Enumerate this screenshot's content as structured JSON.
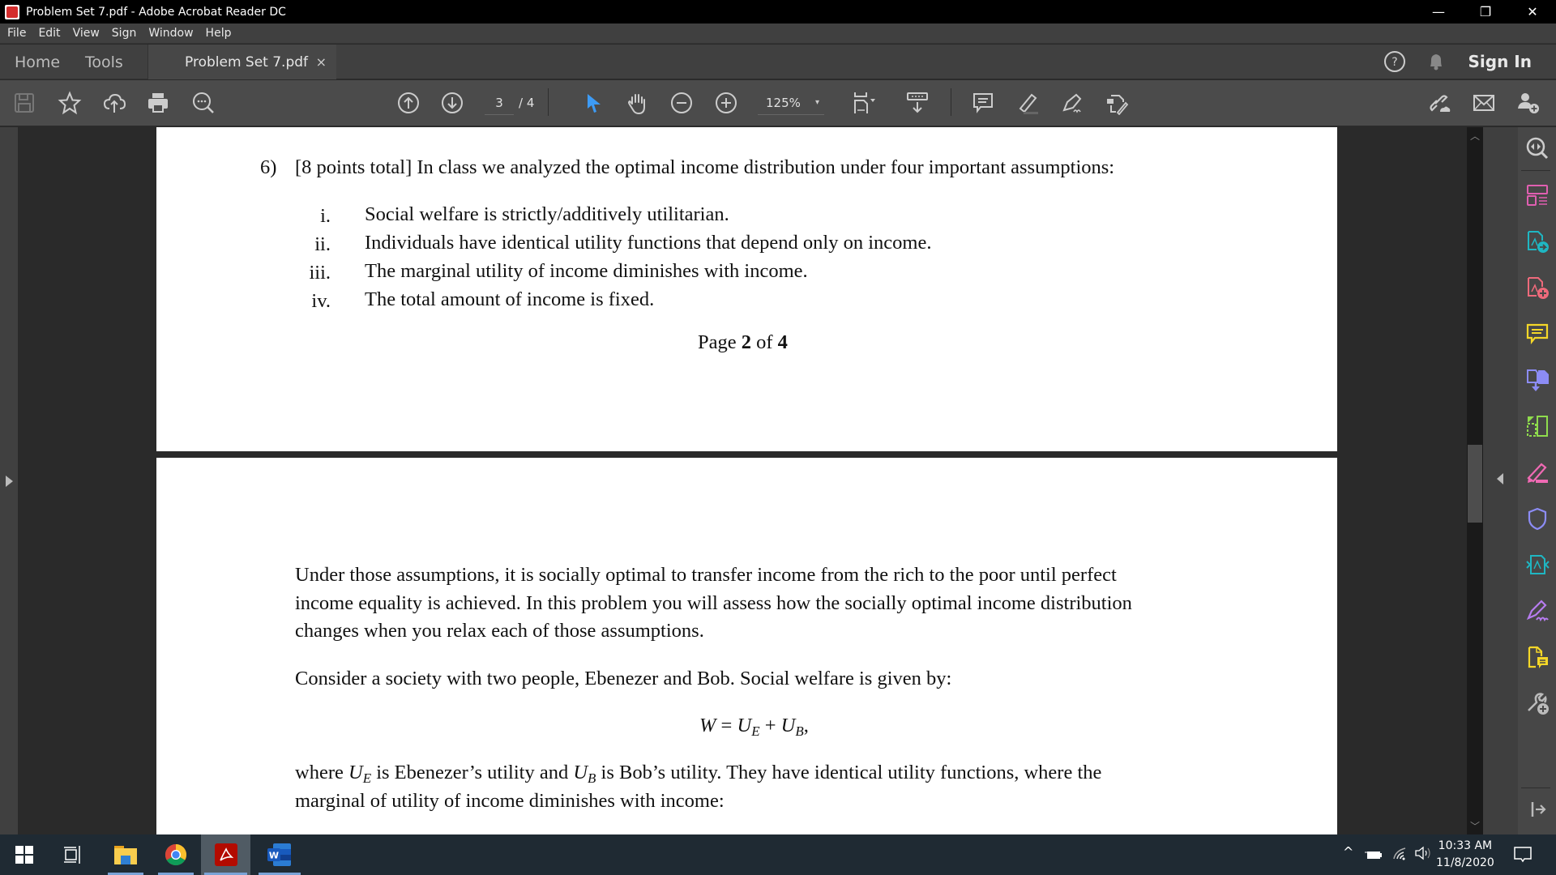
{
  "window": {
    "title": "Problem Set 7.pdf - Adobe Acrobat Reader DC",
    "minimize_glyph": "—",
    "restore_glyph": "❐",
    "close_glyph": "✕"
  },
  "menu": [
    "File",
    "Edit",
    "View",
    "Sign",
    "Window",
    "Help"
  ],
  "tabs": {
    "home": "Home",
    "tools": "Tools",
    "document": "Problem Set 7.pdf",
    "close_glyph": "×",
    "sign_in": "Sign In"
  },
  "toolbar": {
    "current_page": "3",
    "total_pages": "/ 4",
    "zoom": "125%",
    "zoom_caret": "▾",
    "accent_color": "#3d9bf5"
  },
  "document": {
    "page1": {
      "question_number": "6)",
      "question_intro": "[8 points total] In class we analyzed the optimal income distribution under four important assumptions:",
      "assumptions": [
        {
          "numeral": "i.",
          "text": "Social welfare is strictly/additively utilitarian."
        },
        {
          "numeral": "ii.",
          "text": "Individuals have identical utility functions that depend only on income."
        },
        {
          "numeral": "iii.",
          "text": "The marginal utility of income diminishes with income."
        },
        {
          "numeral": "iv.",
          "text": "The total amount of income is fixed."
        }
      ],
      "footer_prefix": "Page ",
      "footer_page": "2",
      "footer_mid": " of ",
      "footer_total": "4"
    },
    "page2": {
      "para1_lines": [
        "Under those assumptions, it is socially optimal to transfer income from the rich to the poor until perfect",
        "income equality is achieved.  In this problem you will assess how the socially optimal income distribution",
        "changes when you relax each of those assumptions."
      ],
      "para2": "Consider a society with two people, Ebenezer and Bob.  Social welfare is given by:",
      "equation": {
        "lhs": "W",
        "eq": " = ",
        "u1": "U",
        "s1": "E",
        "plus": " + ",
        "u2": "U",
        "s2": "B",
        "tail": ","
      },
      "para3_line1": {
        "a": "where ",
        "u1": "U",
        "s1": "E",
        "b": " is Ebenezer’s utility and ",
        "u2": "U",
        "s2": "B",
        "c": " is Bob’s utility.  They have identical utility functions, where the"
      },
      "para3_line2": "marginal of utility of income diminishes with income:"
    }
  },
  "taskbar": {
    "time": "10:33 AM",
    "date": "11/8/2020",
    "tray_up_glyph": "^",
    "apps": [
      "start",
      "task-view",
      "file-explorer",
      "chrome",
      "acrobat",
      "word"
    ],
    "word_letter": "W"
  }
}
